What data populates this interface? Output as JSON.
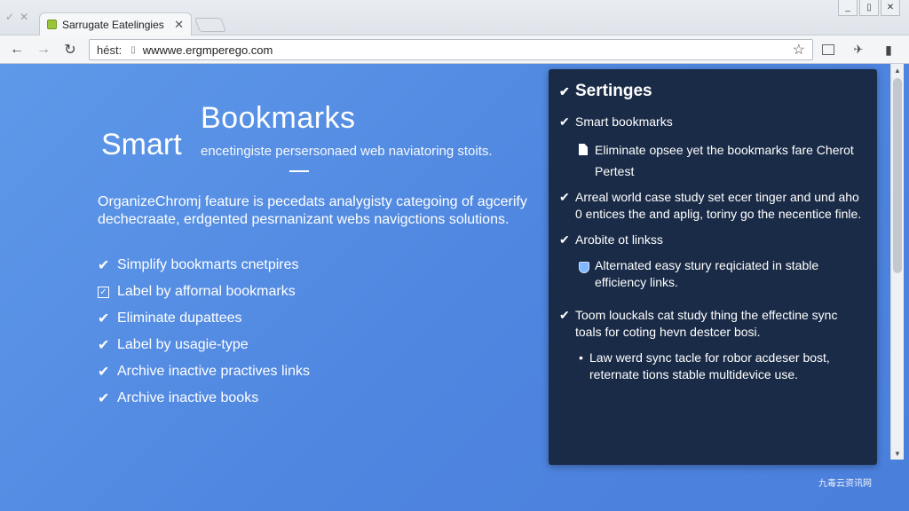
{
  "browser": {
    "tab_title": "Sarrugate Eatelingies",
    "url_scheme": "hést:",
    "url": "wwwwe.ergmperego.com",
    "window_controls": [
      "_",
      "▯",
      "✕"
    ],
    "toolbar_right_icons": [
      "ext-icon",
      "run-icon",
      "menu-icon"
    ]
  },
  "hero": {
    "title_line1": "Bookmarks",
    "title_line2": "Smart",
    "subtitle": "encetingiste persersonaed web naviatoring stoits.",
    "description": "OrganizeChromj feature is pecedats analygisty categoing of agcerify dechecraate, erdgented pesrnanizant webs navigctions solutions.",
    "features": [
      {
        "icon": "check",
        "label": "Simplify bookmarts cnetpires"
      },
      {
        "icon": "box",
        "label": "Label by affornal bookmarks"
      },
      {
        "icon": "check",
        "label": "Eliminate dupattees"
      },
      {
        "icon": "check",
        "label": "Label by usagie-type"
      },
      {
        "icon": "check",
        "label": "Archive inactive practives links"
      },
      {
        "icon": "check",
        "label": "Archive inactive books"
      }
    ]
  },
  "panel": {
    "title": "Sertinges",
    "items": [
      {
        "kind": "check",
        "text": "Smart bookmarks"
      },
      {
        "kind": "doc",
        "text": "Eliminate opsee yet the bookmarks fare Cherot Pertest"
      },
      {
        "kind": "check",
        "text": "Arreal world case study set ecer tinger and und aho 0 entices the and aplig, toriny go the necentice finle."
      },
      {
        "kind": "check",
        "text": "Arobite ot linkss"
      },
      {
        "kind": "shield",
        "text": "Alternated easy stury reqiciated in stable efficiency links."
      },
      {
        "kind": "check",
        "text": "Toom louckals cat study thing the effectine sync toals for coting hevn destcer bosi."
      },
      {
        "kind": "bullet",
        "text": "Law werd sync tacle for robor acdeser bost, reternate tions stable multidevice use."
      }
    ]
  },
  "watermark": "九毒云资讯网",
  "colors": {
    "background": "#5a93e6",
    "panel": "#1a2b47",
    "accent_green": "#9cc43a"
  }
}
